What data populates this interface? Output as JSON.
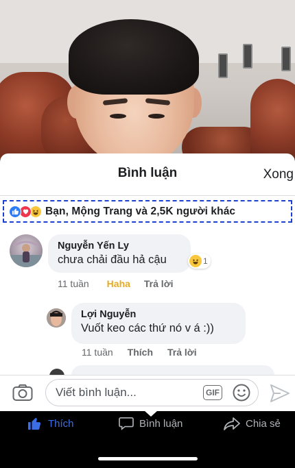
{
  "sheet": {
    "title": "Bình luận",
    "done_label": "Xong"
  },
  "reactions": {
    "icons": [
      "like-icon",
      "love-icon",
      "haha-icon"
    ],
    "summary": "Bạn, Mộng Trang và 2,5K người khác"
  },
  "comments": [
    {
      "author": "Nguyễn Yến Ly",
      "text": "chưa chải đầu hả cậu",
      "time": "11 tuần",
      "reaction_label": "Haha",
      "reply_label": "Trả lời",
      "reaction_count": "1"
    },
    {
      "author": "Lợi Nguyễn",
      "text": "Vuốt keo các thứ nó v á :))",
      "time": "11 tuần",
      "like_label": "Thích",
      "reply_label": "Trả lời"
    }
  ],
  "composer": {
    "placeholder": "Viết bình luận...",
    "gif_label": "GIF"
  },
  "action_bar": {
    "like_label": "Thích",
    "comment_label": "Bình luận",
    "share_label": "Chia sẻ"
  },
  "colors": {
    "like_blue": "#2e7cf6",
    "love_red": "#f0364e",
    "haha_yellow": "#f8c73b",
    "haha_text": "#e6a922",
    "selection_outline": "#1b3fd0"
  }
}
